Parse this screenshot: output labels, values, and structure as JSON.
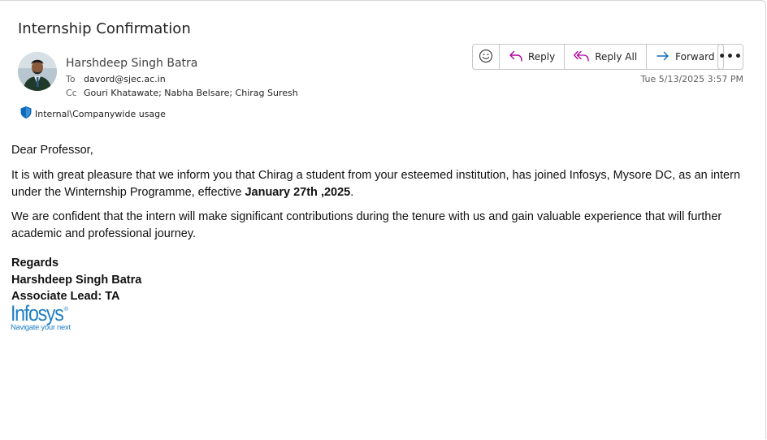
{
  "email": {
    "subject": "Internship Confirmation",
    "sender": "Harshdeep Singh Batra",
    "to_label": "To",
    "to": "davord@sjec.ac.in",
    "cc_label": "Cc",
    "cc": "Gouri Khatawate; Nabha Belsare; Chirag Suresh",
    "sensitivity": "Internal\\Companywide usage",
    "date": "Tue 5/13/2025 3:57 PM"
  },
  "toolbar": {
    "reply_label": "Reply",
    "reply_all_label": "Reply All",
    "forward_label": "Forward",
    "more_label": "•••"
  },
  "body": {
    "greeting": "Dear Professor,",
    "para1_pre": "It is with great pleasure that we inform you that Chirag a  student from your esteemed institution, has joined Infosys, Mysore DC, as an intern under the Winternship Programme, effective ",
    "para1_bold": "January 27th ,2025",
    "para1_post": ".",
    "para2": "We are confident that the intern will make significant contributions during the tenure with us and gain valuable experience that will further academic and professional journey."
  },
  "signature": {
    "regards": "Regards",
    "name": "Harshdeep Singh Batra",
    "title": "Associate Lead: TA",
    "logo_text": "Infosys",
    "logo_mark": "®",
    "logo_tagline": "Navigate your next"
  },
  "colors": {
    "accent": "#1f7fc4",
    "reply_icon": "#b4009e",
    "forward_icon": "#0f6cbd",
    "shield": "#0f6cbd"
  }
}
